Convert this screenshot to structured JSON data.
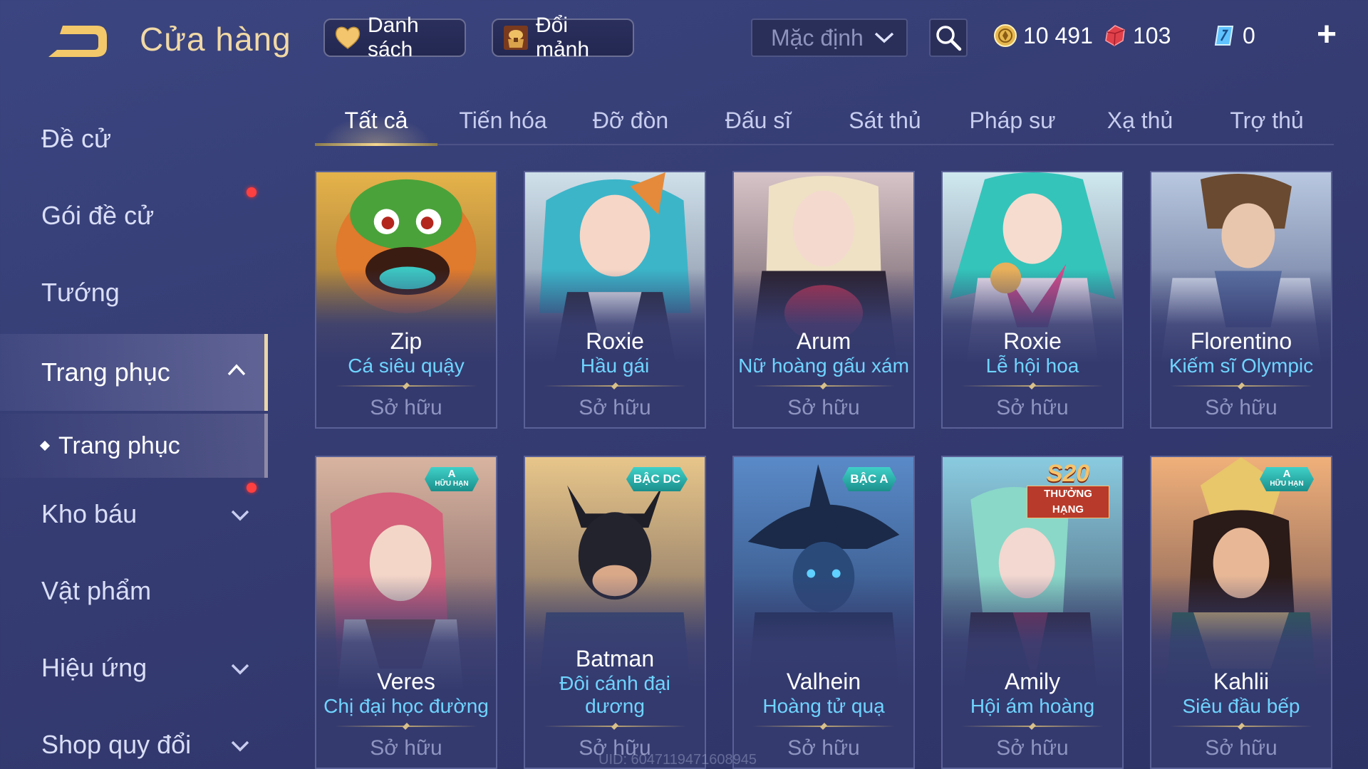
{
  "header": {
    "title": "Cửa hàng",
    "wishlist_label": "Danh sách",
    "exchange_label": "Đổi mảnh",
    "sort_value": "Mặc định",
    "currencies": {
      "gold": "10 491",
      "voucher": "103",
      "quan_huy": "0"
    },
    "plus_label": "+"
  },
  "sidebar": {
    "items": [
      {
        "label": "Đề cử"
      },
      {
        "label": "Gói đề cử"
      },
      {
        "label": "Tướng"
      },
      {
        "label": "Trang phục"
      },
      {
        "label": "Kho báu"
      },
      {
        "label": "Vật phẩm"
      },
      {
        "label": "Hiệu ứng"
      },
      {
        "label": "Shop quy đổi"
      }
    ],
    "sub_item": {
      "label": "Trang phục"
    }
  },
  "tabs": [
    {
      "label": "Tất cả"
    },
    {
      "label": "Tiến hóa"
    },
    {
      "label": "Đỡ đòn"
    },
    {
      "label": "Đấu sĩ"
    },
    {
      "label": "Sát thủ"
    },
    {
      "label": "Pháp sư"
    },
    {
      "label": "Xạ thủ"
    },
    {
      "label": "Trợ thủ"
    }
  ],
  "cards": [
    {
      "hero": "Zip",
      "skin": "Cá siêu quậy",
      "status": "Sở hữu"
    },
    {
      "hero": "Roxie",
      "skin": "Hầu gái",
      "status": "Sở hữu"
    },
    {
      "hero": "Arum",
      "skin": "Nữ hoàng gấu xám",
      "status": "Sở hữu"
    },
    {
      "hero": "Roxie",
      "skin": "Lễ hội hoa",
      "status": "Sở hữu"
    },
    {
      "hero": "Florentino",
      "skin": "Kiếm sĩ Olympic",
      "status": "Sở hữu"
    },
    {
      "hero": "Veres",
      "skin": "Chị đại học đường",
      "status": "Sở hữu",
      "badge_top": "A",
      "badge_bottom": "HỮU HẠN"
    },
    {
      "hero": "Batman",
      "skin": "Đôi cánh đại dương",
      "status": "Sở hữu",
      "badge": "BẬC DC"
    },
    {
      "hero": "Valhein",
      "skin": "Hoàng tử quạ",
      "status": "Sở hữu",
      "badge": "BẬC A"
    },
    {
      "hero": "Amily",
      "skin": "Hội ám hoàng",
      "status": "Sở hữu",
      "rank_top": "S20",
      "rank_bottom": "THƯỞNG HẠNG"
    },
    {
      "hero": "Kahlii",
      "skin": "Siêu đầu bếp",
      "status": "Sở hữu",
      "badge_top": "A",
      "badge_bottom": "HỮU HẠN"
    }
  ],
  "footer": {
    "uid": "UID: 6047119471608945"
  },
  "colors": {
    "background": "#353c72",
    "title_gold": "#f1d9a6",
    "skin_name_cyan": "#6fd4ff",
    "notification_red": "#ff4040"
  },
  "icons": {
    "back": "back-arrow-icon",
    "wishlist": "heart-icon",
    "exchange": "chest-icon",
    "sort": "chevron-down-icon",
    "search": "search-icon",
    "gold": "gold-coin-icon",
    "voucher": "voucher-gem-icon",
    "quan_huy": "quan-huy-icon",
    "add": "plus-icon"
  }
}
